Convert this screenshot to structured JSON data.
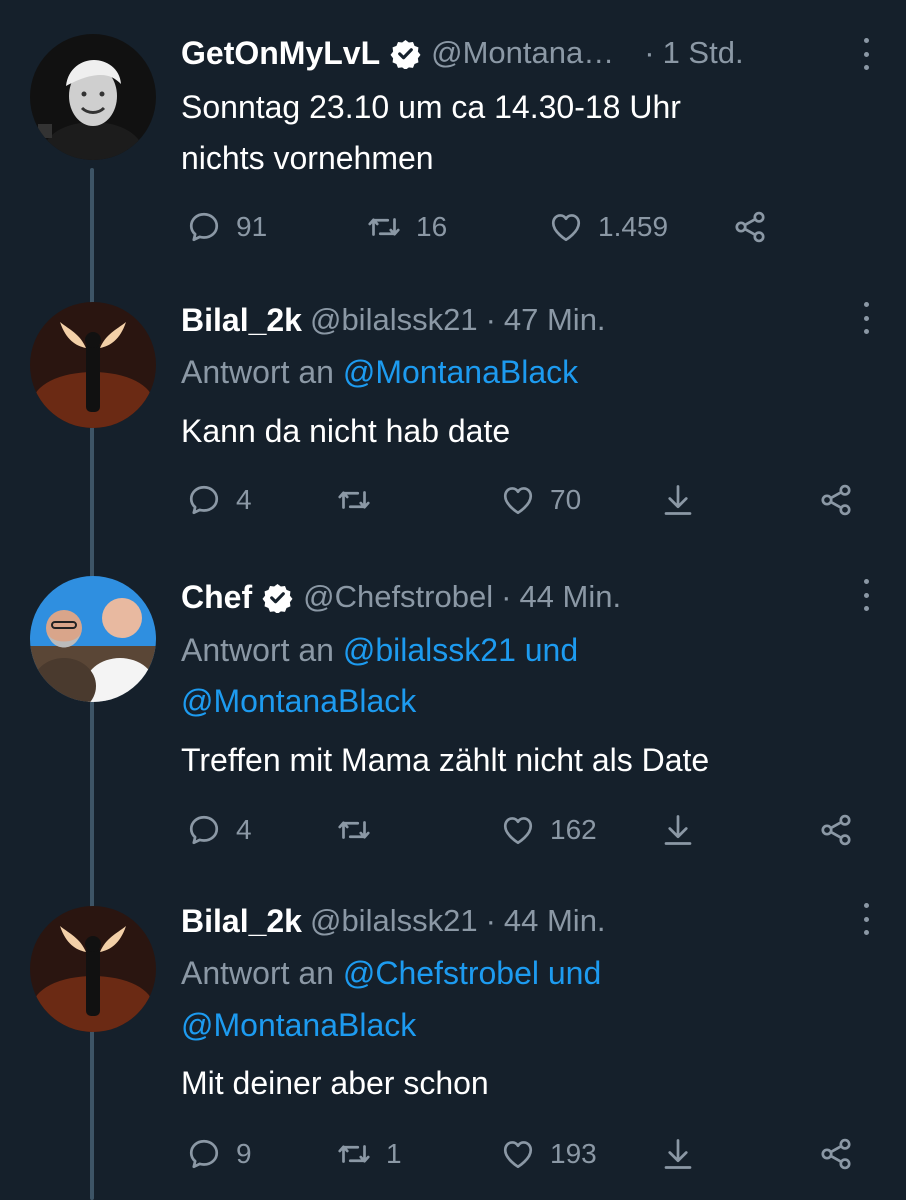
{
  "tweets": [
    {
      "name": "GetOnMyLvL",
      "verified": true,
      "handle": "@Montana…",
      "sep": "·",
      "time": "1 Std.",
      "lines": [
        "Sonntag 23.10 um ca 14.30-18 Uhr",
        "nichts vornehmen"
      ],
      "replies": "91",
      "retweets": "16",
      "likes": "1.459"
    },
    {
      "name": "Bilal_2k",
      "handle": "@bilalssk21",
      "sep": "·",
      "time": "47 Min.",
      "reply_prefix": "Antwort an",
      "reply_to_line1": "@MontanaBlack",
      "text": "Kann da nicht hab date",
      "replies": "4",
      "retweets": "",
      "likes": "70"
    },
    {
      "name": "Chef",
      "verified": true,
      "handle": "@Chefstrobel",
      "sep": "·",
      "time": "44 Min.",
      "reply_prefix": "Antwort an",
      "reply_to_line1": "@bilalssk21 und",
      "reply_to_line2": "@MontanaBlack",
      "text": "Treffen mit Mama zählt nicht als Date",
      "replies": "4",
      "retweets": "",
      "likes": "162"
    },
    {
      "name": "Bilal_2k",
      "handle": "@bilalssk21",
      "sep": "·",
      "time": "44 Min.",
      "reply_prefix": "Antwort an",
      "reply_to_line1": "@Chefstrobel und",
      "reply_to_line2": "@MontanaBlack",
      "text": "Mit deiner aber schon",
      "replies": "9",
      "retweets": "1",
      "likes": "193"
    }
  ],
  "colors": {
    "background": "#15202b",
    "text": "#ffffff",
    "muted": "#8b98a5",
    "link": "#1d9bf0",
    "verified": "#ffffff"
  },
  "icons": [
    "reply-icon",
    "retweet-icon",
    "like-icon",
    "share-icon",
    "download-icon",
    "verified-badge-icon",
    "more-icon"
  ]
}
